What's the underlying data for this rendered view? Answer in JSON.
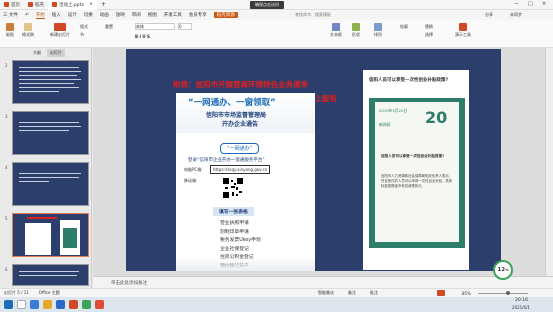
{
  "titlebar": {
    "tabs": [
      {
        "label": "首页",
        "color": "#d24726"
      },
      {
        "label": "稻壳",
        "color": "#d24726"
      },
      {
        "label": "活动上.pptx",
        "color": "#d24726"
      }
    ],
    "plus": "+",
    "right_label": "确保点击访问"
  },
  "menu": {
    "items": [
      "三 文件",
      "开始",
      "插入",
      "设计",
      "切换",
      "动画",
      "放映",
      "审阅",
      "视图",
      "开发工具",
      "会员专享",
      "稻壳资源"
    ],
    "active_index": 1,
    "search": "查找命令、搜索模板",
    "right": [
      "分享",
      "未同步"
    ]
  },
  "ribbon": {
    "buttons": [
      "粘贴",
      "格式刷",
      "新建幻灯片",
      "版式",
      "节",
      "重置",
      "文本框",
      "形状",
      "排列",
      "轮廓",
      "替换",
      "选择",
      "演示工具"
    ],
    "font_name": "宋体",
    "font_size": "0"
  },
  "leftpanel": {
    "tabs": [
      "大纲",
      "幻灯片"
    ],
    "thumb_numbers": [
      "2",
      "3",
      "4",
      "5",
      "6"
    ]
  },
  "slide": {
    "red_line1": "附表：信阳市开展营商环境特色业务清单",
    "red_line2": "网办、掌上办、全程网办“一网通”网上服务",
    "poster": {
      "headline": "“一网通办、一窗领取”",
      "sub1": "信阳市市场监督管理局",
      "sub2": "开办企业通告",
      "button": "“一网通办”",
      "login_line": "登录“信阳市企业开办一窗通服务平台”",
      "pc_label": "电脑PC端:",
      "url": "https://ssqy.xinyang.gov.cn",
      "mobile_label": "移动端:",
      "fill_btn": "填写一张表格",
      "items": [
        "营业执照申请",
        "刻制印章申请",
        "税务发票Ukey申领",
        "企业社保登记",
        "住房公积金登记",
        "预约银行开户"
      ]
    },
    "card": {
      "question": "信阳人员可以享受一次性创业补贴政策?",
      "book_date": "2019年5月20日",
      "book_number": "20",
      "book_tag": "新闻纸",
      "q_inner": "信阳人员可以享受一次性创业补贴政策?",
      "body": "信阳市人力资源和社会保障局相关负责人表示，符合条件的人员可以申请一次性创业补贴，具体标准按照省市有关政策执行。"
    }
  },
  "notes": {
    "placeholder": "单击此处添加备注"
  },
  "zoom_badge": {
    "value": "12",
    "unit": "%"
  },
  "statusbar": {
    "slide_info": "幻灯片 5 / 11",
    "theme": "Office 主题",
    "right_items": [
      "智能美化",
      "备注",
      "批注"
    ],
    "zoom": "85%"
  },
  "taskbar": {
    "time": "20:16",
    "date": "2021/6/1"
  },
  "colors": {
    "slide_bg": "#2c3e6b",
    "accent_red": "#e02020",
    "teal": "#2e7d6b",
    "wps_orange": "#c55a11"
  }
}
